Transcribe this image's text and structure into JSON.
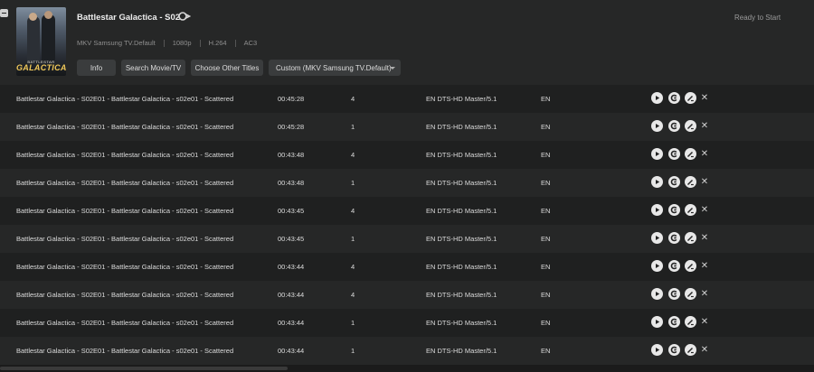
{
  "header": {
    "title": "Battlestar Galactica - S02",
    "disc_icon": "bluray-disc-icon",
    "status": "Ready to Start",
    "poster": {
      "line1": "BATTLESTAR",
      "line2": "GALACTICA"
    },
    "meta": {
      "profile": "MKV Samsung TV.Default",
      "resolution": "1080p",
      "codec": "H.264",
      "audio": "AC3"
    },
    "buttons": {
      "info": "Info",
      "search": "Search Movie/TV",
      "choose": "Choose Other Titles",
      "profile": "Custom (MKV Samsung TV.Default)"
    }
  },
  "titles": [
    {
      "name": "Battlestar Galactica - S02E01 - Battlestar Galactica - s02e01 - Scattered",
      "duration": "00:45:28",
      "chapters": "4",
      "audio": "EN  DTS-HD Master/5.1",
      "subtitle": "EN"
    },
    {
      "name": "Battlestar Galactica - S02E01 - Battlestar Galactica - s02e01 - Scattered",
      "duration": "00:45:28",
      "chapters": "1",
      "audio": "EN  DTS-HD Master/5.1",
      "subtitle": "EN"
    },
    {
      "name": "Battlestar Galactica - S02E01 - Battlestar Galactica - s02e01 - Scattered",
      "duration": "00:43:48",
      "chapters": "4",
      "audio": "EN  DTS-HD Master/5.1",
      "subtitle": "EN"
    },
    {
      "name": "Battlestar Galactica - S02E01 - Battlestar Galactica - s02e01 - Scattered",
      "duration": "00:43:48",
      "chapters": "1",
      "audio": "EN  DTS-HD Master/5.1",
      "subtitle": "EN"
    },
    {
      "name": "Battlestar Galactica - S02E01 - Battlestar Galactica - s02e01 - Scattered",
      "duration": "00:43:45",
      "chapters": "4",
      "audio": "EN  DTS-HD Master/5.1",
      "subtitle": "EN"
    },
    {
      "name": "Battlestar Galactica - S02E01 - Battlestar Galactica - s02e01 - Scattered",
      "duration": "00:43:45",
      "chapters": "1",
      "audio": "EN  DTS-HD Master/5.1",
      "subtitle": "EN"
    },
    {
      "name": "Battlestar Galactica - S02E01 - Battlestar Galactica - s02e01 - Scattered",
      "duration": "00:43:44",
      "chapters": "4",
      "audio": "EN  DTS-HD Master/5.1",
      "subtitle": "EN"
    },
    {
      "name": "Battlestar Galactica - S02E01 - Battlestar Galactica - s02e01 - Scattered",
      "duration": "00:43:44",
      "chapters": "4",
      "audio": "EN  DTS-HD Master/5.1",
      "subtitle": "EN"
    },
    {
      "name": "Battlestar Galactica - S02E01 - Battlestar Galactica - s02e01 - Scattered",
      "duration": "00:43:44",
      "chapters": "1",
      "audio": "EN  DTS-HD Master/5.1",
      "subtitle": "EN"
    },
    {
      "name": "Battlestar Galactica - S02E01 - Battlestar Galactica - s02e01 - Scattered",
      "duration": "00:43:44",
      "chapters": "1",
      "audio": "EN  DTS-HD Master/5.1",
      "subtitle": "EN"
    }
  ],
  "row_actions": {
    "play_icon": "play-icon",
    "copy_icon": "preview-icon",
    "edit_icon": "edit-icon",
    "delete_icon": "close-icon",
    "delete_glyph": "✕"
  }
}
